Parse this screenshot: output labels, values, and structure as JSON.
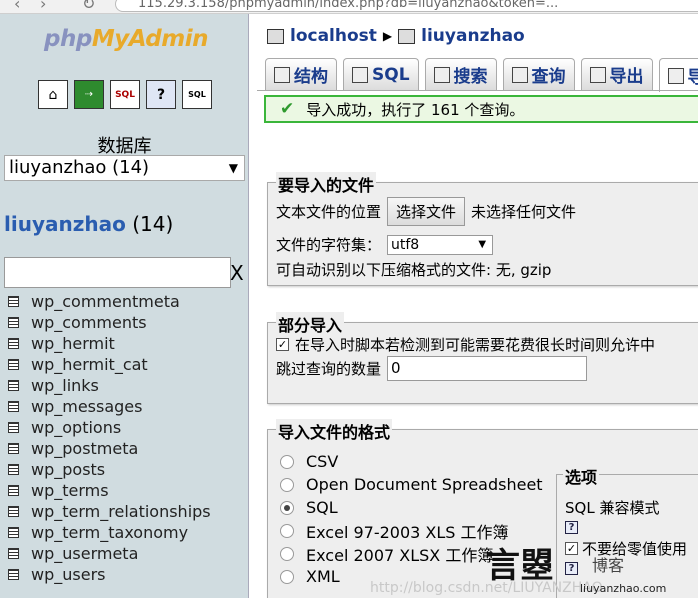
{
  "browser": {
    "url": "115.29.3.158/phpmyadmin/index.php?db=liuyanzhao&token=..."
  },
  "sidebar": {
    "logo_php": "php",
    "logo_my": "MyAdmin",
    "icons": [
      "home-icon",
      "exit-icon",
      "sql-icon",
      "help-icon",
      "sql-docs-icon"
    ],
    "db_heading": "数据库",
    "db_select": "liuyanzhao (14)",
    "db_name": "liuyanzhao",
    "db_count": "(14)",
    "filter_clear": "X",
    "tables": [
      "wp_commentmeta",
      "wp_comments",
      "wp_hermit",
      "wp_hermit_cat",
      "wp_links",
      "wp_messages",
      "wp_options",
      "wp_postmeta",
      "wp_posts",
      "wp_terms",
      "wp_term_relationships",
      "wp_term_taxonomy",
      "wp_usermeta",
      "wp_users"
    ]
  },
  "breadcrumb": {
    "server": "localhost",
    "database": "liuyanzhao"
  },
  "tabs": [
    {
      "label": "结构"
    },
    {
      "label": "SQL"
    },
    {
      "label": "搜索"
    },
    {
      "label": "查询"
    },
    {
      "label": "导出"
    },
    {
      "label": "导入"
    }
  ],
  "message": {
    "success": "导入成功，执行了 161 个查询。"
  },
  "import_file": {
    "legend": "要导入的文件",
    "location_label": "文本文件的位置",
    "choose_button": "选择文件",
    "no_file": "未选择任何文件",
    "charset_label": "文件的字符集：",
    "charset_value": "utf8",
    "compression_note": "可自动识别以下压缩格式的文件: 无, gzip"
  },
  "partial_import": {
    "legend": "部分导入",
    "allow_interrupt": "在导入时脚本若检测到可能需要花费很长时间则允许中",
    "skip_label": "跳过查询的数量",
    "skip_value": "0"
  },
  "format": {
    "legend": "导入文件的格式",
    "options": [
      "CSV",
      "Open Document Spreadsheet",
      "SQL",
      "Excel 97-2003 XLS 工作簿",
      "Excel 2007 XLSX 工作簿",
      "XML"
    ],
    "selected": "SQL",
    "options_legend": "选项",
    "sql_compat": "SQL 兼容模式",
    "no_auto_zero": "不要给零值使用"
  },
  "watermark": {
    "url": "http://blog.csdn.net/LIUYANZHAO",
    "brand": "言曌",
    "brand_sub": "博客",
    "site": "liuyanzhao.com"
  }
}
